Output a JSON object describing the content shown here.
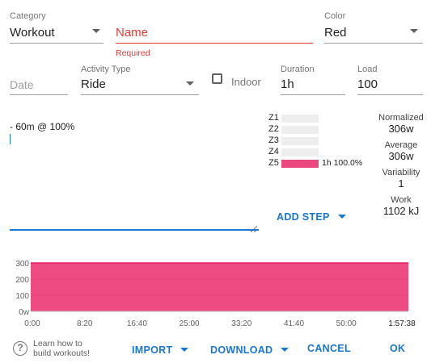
{
  "form": {
    "category": {
      "label": "Category",
      "value": "Workout"
    },
    "name": {
      "placeholder": "Name",
      "error": "Required"
    },
    "color": {
      "label": "Color",
      "value": "Red"
    },
    "date": {
      "placeholder": "Date"
    },
    "activity_type": {
      "label": "Activity Type",
      "value": "Ride"
    },
    "indoor": {
      "label": "Indoor",
      "checked": false
    },
    "duration": {
      "label": "Duration",
      "value": "1h"
    },
    "load": {
      "label": "Load",
      "value": "100"
    }
  },
  "editor": {
    "text": "- 60m @ 100%"
  },
  "zones": [
    {
      "name": "Z1",
      "fill": 0,
      "text": ""
    },
    {
      "name": "Z2",
      "fill": 0,
      "text": ""
    },
    {
      "name": "Z3",
      "fill": 0,
      "text": ""
    },
    {
      "name": "Z4",
      "fill": 0,
      "text": ""
    },
    {
      "name": "Z5",
      "fill": 1,
      "text": "1h 100.0%"
    }
  ],
  "stats": {
    "normalized": {
      "label": "Normalized",
      "value": "306w"
    },
    "average": {
      "label": "Average",
      "value": "306w"
    },
    "variability": {
      "label": "Variability",
      "value": "1"
    },
    "work": {
      "label": "Work",
      "value": "1102 kJ"
    }
  },
  "add_step": "ADD STEP",
  "chart_data": {
    "type": "area",
    "x_ticks": [
      "0:00",
      "8:20",
      "16:40",
      "25:00",
      "33:20",
      "41:40",
      "50:00",
      "1:57:38"
    ],
    "y_ticks": [
      "300",
      "200",
      "100",
      "0w"
    ],
    "ylim": [
      0,
      300
    ],
    "series": [
      {
        "values": [
          300,
          300
        ]
      }
    ],
    "color": "#e91e63"
  },
  "footer": {
    "help": "Learn how to build workouts!",
    "help_line1": "Learn how to",
    "help_line2": "build workouts!",
    "import": "IMPORT",
    "download": "DOWNLOAD",
    "cancel": "CANCEL",
    "ok": "OK"
  }
}
